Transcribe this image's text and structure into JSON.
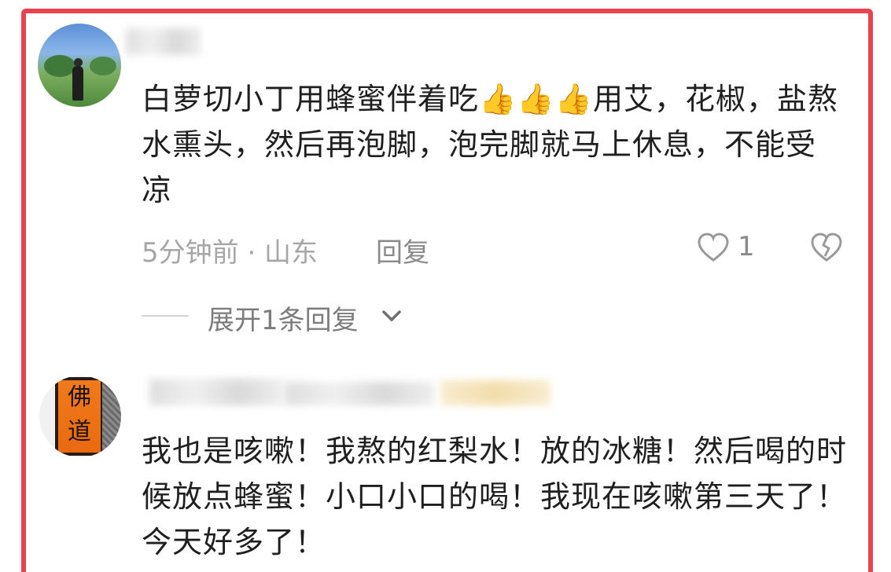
{
  "comments": [
    {
      "username": "",
      "text_before": "白萝切小丁用蜂蜜伴着吃",
      "emoji": "👍👍👍",
      "text_after": "用艾，花椒，盐熬水熏头，然后再泡脚，泡完脚就马上休息，不能受凉",
      "time_location": "5分钟前 · 山东",
      "reply_label": "回复",
      "like_count": "1",
      "expand_label": "展开1条回复"
    },
    {
      "username": "",
      "avatar_text": [
        "佛",
        "道"
      ],
      "text": "我也是咳嗽！我熬的红梨水！放的冰糖！然后喝的时候放点蜂蜜！小口小口的喝！我现在咳嗽第三天了！今天好多了！"
    }
  ],
  "icons": [
    "heart-outline-icon",
    "broken-heart-icon",
    "chevron-down-icon",
    "thumbs-up-icon"
  ],
  "colors": {
    "frame": "#e8434f",
    "text": "#1f1f1f",
    "meta": "#a6a6a6"
  }
}
